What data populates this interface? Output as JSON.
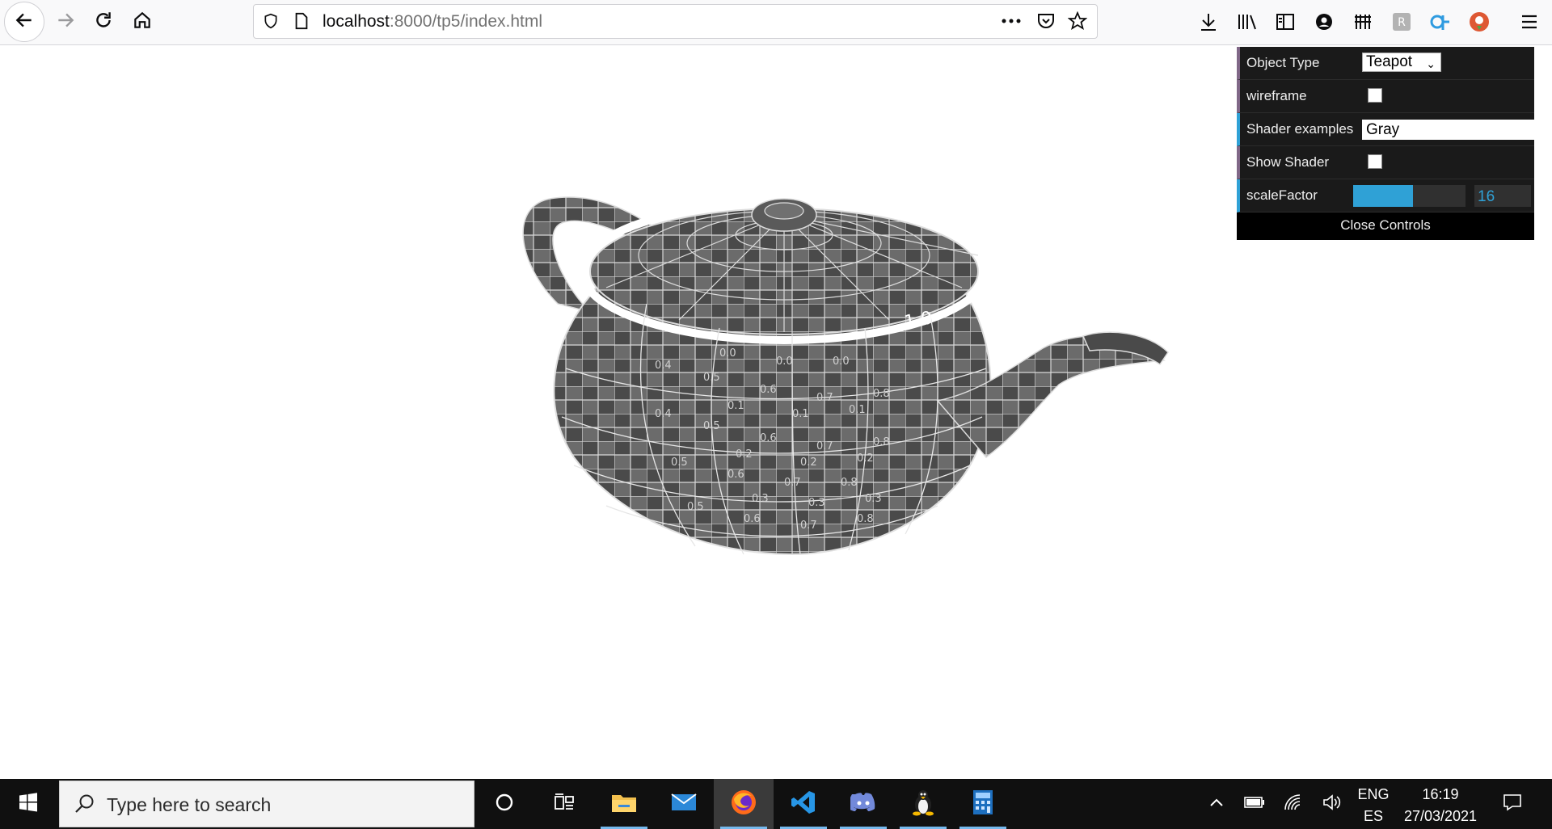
{
  "browser": {
    "url_host": "localhost",
    "url_rest": ":8000/tp5/index.html",
    "nav_icons": [
      "back-arrow-icon",
      "forward-arrow-icon",
      "reload-icon",
      "home-icon"
    ],
    "toolbar_icons": [
      "downloads-icon",
      "library-icon",
      "sidebar-icon",
      "account-icon",
      "extension-icon",
      "extension-icon",
      "extension-icon",
      "extension-icon",
      "menu-icon"
    ]
  },
  "controls": {
    "object_type_label": "Object Type",
    "object_type_value": "Teapot",
    "wireframe_label": "wireframe",
    "wireframe_checked": false,
    "shader_label": "Shader examples",
    "shader_value": "Gray",
    "show_shader_label": "Show Shader",
    "show_shader_checked": false,
    "scale_label": "scaleFactor",
    "scale_value": "16",
    "scale_fraction": 0.53,
    "close_label": "Close Controls",
    "colors": {
      "number": "#2fa1d6",
      "bool": "#806787",
      "panel": "#1a1a1a"
    }
  },
  "canvas": {
    "object": "teapot",
    "texture_labels": [
      "0.0",
      "0.1",
      "0.2",
      "0.3",
      "0.4",
      "0.5",
      "0.6",
      "0.7",
      "0.8",
      "1.0"
    ]
  },
  "taskbar": {
    "search_placeholder": "Type here to search",
    "apps": [
      "cortana-icon",
      "task-view-icon",
      "file-explorer-icon",
      "mail-icon",
      "firefox-icon",
      "vscode-icon",
      "discord-icon",
      "linux-icon",
      "calculator-icon"
    ],
    "lang_top": "ENG",
    "lang_bottom": "ES",
    "time": "16:19",
    "date": "27/03/2021"
  }
}
